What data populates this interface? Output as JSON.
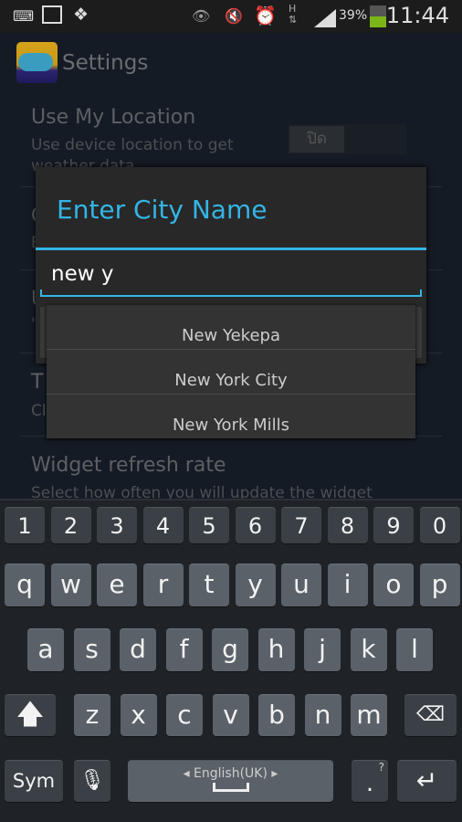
{
  "status_bar": {
    "icons": [
      "keyboard-icon",
      "image-icon",
      "dropbox-icon",
      "eye-icon",
      "mute-icon",
      "alarm-icon",
      "hspa-data-icon",
      "signal-icon"
    ],
    "battery": "39%",
    "time": "11:44",
    "battery_color": "#7cb518"
  },
  "app": {
    "title": "Settings"
  },
  "prefs": [
    {
      "title": "Use My Location",
      "summary": "Use device location to get weather data",
      "toggle": "ปิด"
    },
    {
      "title": "C",
      "summary": "E"
    },
    {
      "title": "U",
      "summary": "\""
    },
    {
      "title": "T",
      "summary": "Cl"
    },
    {
      "title": "Widget refresh rate",
      "summary": "Select how often you will update the widget"
    }
  ],
  "dialog": {
    "title": "Enter City Name",
    "input_value": "new y",
    "accent": "#33b5e5"
  },
  "suggestions": [
    "New Yekepa",
    "New York City",
    "New York Mills"
  ],
  "keyboard": {
    "numbers": [
      "1",
      "2",
      "3",
      "4",
      "5",
      "6",
      "7",
      "8",
      "9",
      "0"
    ],
    "row1": [
      "q",
      "w",
      "e",
      "r",
      "t",
      "y",
      "u",
      "i",
      "o",
      "p"
    ],
    "row2": [
      "a",
      "s",
      "d",
      "f",
      "g",
      "h",
      "j",
      "k",
      "l"
    ],
    "row3": [
      "z",
      "x",
      "c",
      "v",
      "b",
      "n",
      "m"
    ],
    "sym": "Sym",
    "space": "English(UK)",
    "period": ".",
    "period_hint": "?"
  }
}
